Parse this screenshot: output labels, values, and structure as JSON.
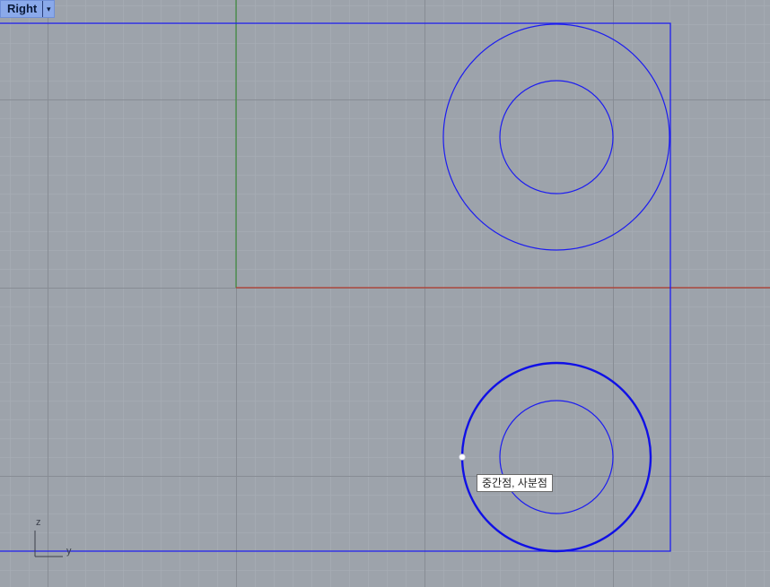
{
  "viewport": {
    "name": "Right",
    "menu_arrow": "▾"
  },
  "snap_tooltip": {
    "text": "중간점, 사분점"
  },
  "axis_widget": {
    "vertical_label": "z",
    "horizontal_label": "y"
  },
  "colors": {
    "background": "#9da3ab",
    "grid_minor": "#a7adb4",
    "grid_major": "#878c94",
    "axis_x": "#b23a2c",
    "axis_y": "#3f8f3f",
    "curve": "#1c1cf0",
    "curve_selected": "#1010e6",
    "snap_point": "#ffffff"
  },
  "icons": {
    "viewport_menu": "triangle-down-icon"
  }
}
